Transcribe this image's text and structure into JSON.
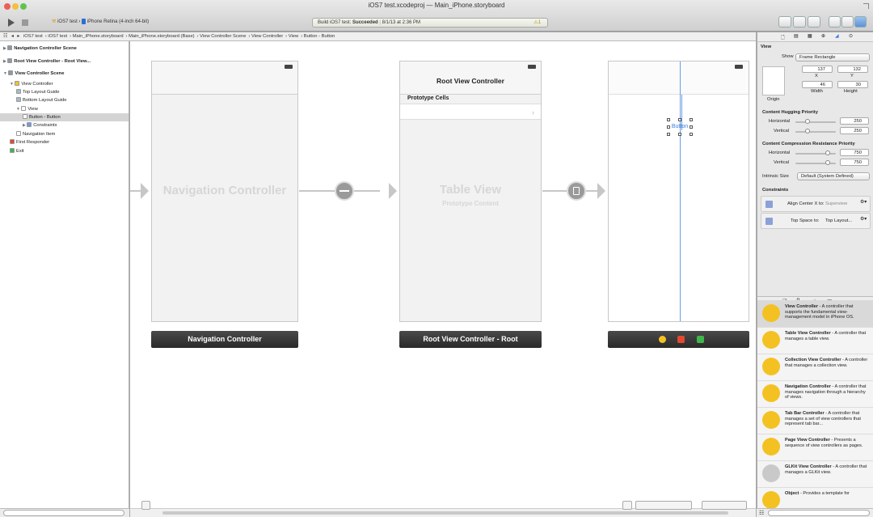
{
  "window": {
    "title": "iOS7 test.xcodeproj — Main_iPhone.storyboard",
    "scheme": "iOS7 test",
    "destination": "iPhone Retina (4-inch 64-bit)",
    "activity_prefix": "Build iOS7 test:",
    "activity_status": "Succeeded",
    "activity_time": "8/1/13 at 2:36 PM",
    "warning_count": "1"
  },
  "jumpbar": [
    "iOS7 test",
    "iOS7 test",
    "Main_iPhone.storyboard",
    "Main_iPhone.storyboard (Base)",
    "View Controller Scene",
    "View Controller",
    "View",
    "Button - Button"
  ],
  "navigator": {
    "items": [
      {
        "label": "Navigation Controller Scene",
        "indent": 0,
        "head": true,
        "icon": "scene-icon"
      },
      {
        "label": "Root View Controller - Root View...",
        "indent": 0,
        "head": true,
        "icon": "scene-icon"
      },
      {
        "label": "View Controller Scene",
        "indent": 0,
        "head": true,
        "icon": "scene-icon"
      },
      {
        "label": "View Controller",
        "indent": 1,
        "head": false,
        "icon": "view-controller-icon"
      },
      {
        "label": "Top Layout Guide",
        "indent": 2,
        "head": false,
        "icon": "layout-guide-icon"
      },
      {
        "label": "Bottom Layout Guide",
        "indent": 2,
        "head": false,
        "icon": "layout-guide-icon"
      },
      {
        "label": "View",
        "indent": 2,
        "head": false,
        "icon": "view-icon"
      },
      {
        "label": "Button - Button",
        "indent": 3,
        "head": false,
        "icon": "button-icon",
        "selected": true
      },
      {
        "label": "Constraints",
        "indent": 3,
        "head": false,
        "icon": "constraints-icon"
      },
      {
        "label": "Navigation Item",
        "indent": 2,
        "head": false,
        "icon": "navigation-item-icon"
      },
      {
        "label": "First Responder",
        "indent": 1,
        "head": false,
        "icon": "first-responder-icon"
      },
      {
        "label": "Exit",
        "indent": 1,
        "head": false,
        "icon": "exit-icon"
      }
    ]
  },
  "canvas": {
    "nav_controller_label": "Navigation Controller",
    "nav_controller_bar": "Navigation Controller",
    "table_nav_title": "Root View Controller",
    "prototype_cells": "Prototype Cells",
    "table_view_label": "Table View",
    "prototype_content": "Prototype Content",
    "root_bar": "Root View Controller - Root",
    "button_text": "Button"
  },
  "inspector": {
    "section": "View",
    "show_label": "Show",
    "show_value": "Frame Rectangle",
    "x": "137",
    "y": "132",
    "width": "46",
    "height": "30",
    "x_label": "X",
    "y_label": "Y",
    "width_label": "Width",
    "height_label": "Height",
    "origin_label": "Origin",
    "hugging_title": "Content Hugging Priority",
    "horizontal_label": "Horizontal",
    "vertical_label": "Vertical",
    "hug_h": "250",
    "hug_v": "250",
    "compression_title": "Content Compression Resistance Priority",
    "comp_h": "750",
    "comp_v": "750",
    "intrinsic_label": "Intrinsic Size",
    "intrinsic_value": "Default (System Defined)",
    "constraints_title": "Constraints",
    "constraint1": "Align Center X to:",
    "constraint1_target": "Superview",
    "constraint2": "Top Space to:",
    "constraint2_target": "Top Layout..."
  },
  "library": {
    "items": [
      {
        "title": "View Controller",
        "desc": " - A controller that supports the fundamental view-management model in iPhone OS.",
        "selected": true
      },
      {
        "title": "Table View Controller",
        "desc": " - A controller that manages a table view."
      },
      {
        "title": "Collection View Controller",
        "desc": " - A controller that manages a collection view."
      },
      {
        "title": "Navigation Controller",
        "desc": " - A controller that manages navigation through a hierarchy of views."
      },
      {
        "title": "Tab Bar Controller",
        "desc": " - A controller that manages a set of view controllers that represent tab bar..."
      },
      {
        "title": "Page View Controller",
        "desc": " - Presents a sequence of view controllers as pages."
      },
      {
        "title": "GLKit View Controller",
        "desc": " - A controller that manages a GLKit view."
      },
      {
        "title": "Object",
        "desc": " - Provides a template for"
      }
    ]
  },
  "colors": {
    "accent": "#3b7ddd",
    "library_icon": "#f3c222",
    "scene_bar": "#333333"
  }
}
